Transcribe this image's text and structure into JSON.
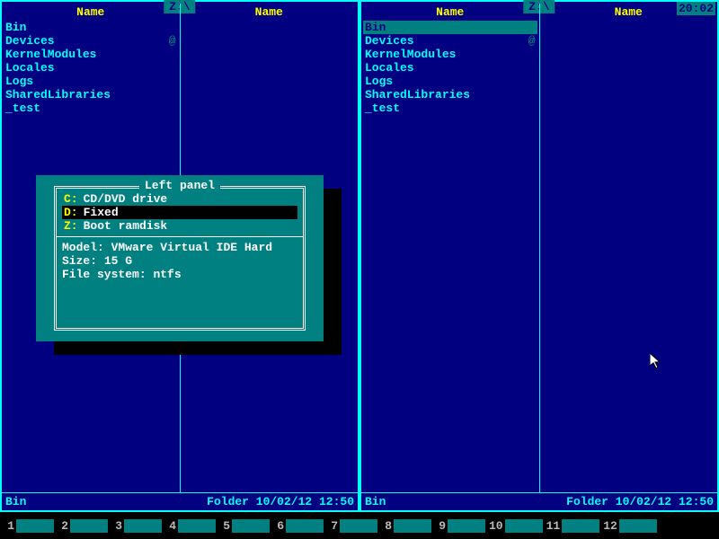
{
  "clock": "20:02",
  "panel_path": "Z:\\",
  "col_header": "Name",
  "left": {
    "files": [
      {
        "name": "Bin",
        "attr": ""
      },
      {
        "name": "Devices",
        "attr": "@"
      },
      {
        "name": "KernelModules",
        "attr": ""
      },
      {
        "name": "Locales",
        "attr": ""
      },
      {
        "name": "Logs",
        "attr": ""
      },
      {
        "name": "SharedLibraries",
        "attr": ""
      },
      {
        "name": "_test",
        "attr": ""
      }
    ],
    "footer_name": "Bin",
    "footer_info": "Folder 10/02/12 12:50"
  },
  "right": {
    "files": [
      {
        "name": "Bin",
        "attr": "",
        "selected": true
      },
      {
        "name": "Devices",
        "attr": "@"
      },
      {
        "name": "KernelModules",
        "attr": ""
      },
      {
        "name": "Locales",
        "attr": ""
      },
      {
        "name": "Logs",
        "attr": ""
      },
      {
        "name": "SharedLibraries",
        "attr": ""
      },
      {
        "name": "_test",
        "attr": ""
      }
    ],
    "footer_name": "Bin",
    "footer_info": "Folder 10/02/12 12:50"
  },
  "dialog": {
    "title": "Left panel",
    "drives": [
      {
        "letter": "C:",
        "label": "CD/DVD drive",
        "selected": false
      },
      {
        "letter": "D:",
        "label": "Fixed",
        "selected": true
      },
      {
        "letter": "Z:",
        "label": "Boot ramdisk",
        "selected": false
      }
    ],
    "info": {
      "model_label": "Model:",
      "model_value": "VMware Virtual IDE Hard",
      "size_label": "Size:",
      "size_value": "15 G",
      "fs_label": "File system:",
      "fs_value": "ntfs"
    }
  },
  "fkeys": [
    "1",
    "2",
    "3",
    "4",
    "5",
    "6",
    "7",
    "8",
    "9",
    "10",
    "11",
    "12"
  ]
}
